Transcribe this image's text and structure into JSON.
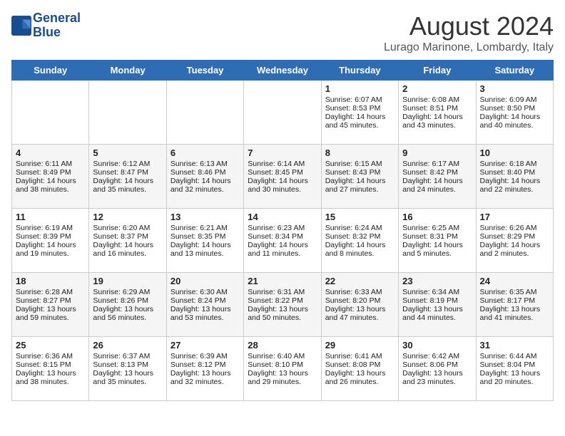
{
  "logo": {
    "line1": "General",
    "line2": "Blue"
  },
  "title": "August 2024",
  "subtitle": "Lurago Marinone, Lombardy, Italy",
  "days_of_week": [
    "Sunday",
    "Monday",
    "Tuesday",
    "Wednesday",
    "Thursday",
    "Friday",
    "Saturday"
  ],
  "weeks": [
    [
      {
        "day": "",
        "info": ""
      },
      {
        "day": "",
        "info": ""
      },
      {
        "day": "",
        "info": ""
      },
      {
        "day": "",
        "info": ""
      },
      {
        "day": "1",
        "info": "Sunrise: 6:07 AM\nSunset: 8:53 PM\nDaylight: 14 hours and 45 minutes."
      },
      {
        "day": "2",
        "info": "Sunrise: 6:08 AM\nSunset: 8:51 PM\nDaylight: 14 hours and 43 minutes."
      },
      {
        "day": "3",
        "info": "Sunrise: 6:09 AM\nSunset: 8:50 PM\nDaylight: 14 hours and 40 minutes."
      }
    ],
    [
      {
        "day": "4",
        "info": "Sunrise: 6:11 AM\nSunset: 8:49 PM\nDaylight: 14 hours and 38 minutes."
      },
      {
        "day": "5",
        "info": "Sunrise: 6:12 AM\nSunset: 8:47 PM\nDaylight: 14 hours and 35 minutes."
      },
      {
        "day": "6",
        "info": "Sunrise: 6:13 AM\nSunset: 8:46 PM\nDaylight: 14 hours and 32 minutes."
      },
      {
        "day": "7",
        "info": "Sunrise: 6:14 AM\nSunset: 8:45 PM\nDaylight: 14 hours and 30 minutes."
      },
      {
        "day": "8",
        "info": "Sunrise: 6:15 AM\nSunset: 8:43 PM\nDaylight: 14 hours and 27 minutes."
      },
      {
        "day": "9",
        "info": "Sunrise: 6:17 AM\nSunset: 8:42 PM\nDaylight: 14 hours and 24 minutes."
      },
      {
        "day": "10",
        "info": "Sunrise: 6:18 AM\nSunset: 8:40 PM\nDaylight: 14 hours and 22 minutes."
      }
    ],
    [
      {
        "day": "11",
        "info": "Sunrise: 6:19 AM\nSunset: 8:39 PM\nDaylight: 14 hours and 19 minutes."
      },
      {
        "day": "12",
        "info": "Sunrise: 6:20 AM\nSunset: 8:37 PM\nDaylight: 14 hours and 16 minutes."
      },
      {
        "day": "13",
        "info": "Sunrise: 6:21 AM\nSunset: 8:35 PM\nDaylight: 14 hours and 13 minutes."
      },
      {
        "day": "14",
        "info": "Sunrise: 6:23 AM\nSunset: 8:34 PM\nDaylight: 14 hours and 11 minutes."
      },
      {
        "day": "15",
        "info": "Sunrise: 6:24 AM\nSunset: 8:32 PM\nDaylight: 14 hours and 8 minutes."
      },
      {
        "day": "16",
        "info": "Sunrise: 6:25 AM\nSunset: 8:31 PM\nDaylight: 14 hours and 5 minutes."
      },
      {
        "day": "17",
        "info": "Sunrise: 6:26 AM\nSunset: 8:29 PM\nDaylight: 14 hours and 2 minutes."
      }
    ],
    [
      {
        "day": "18",
        "info": "Sunrise: 6:28 AM\nSunset: 8:27 PM\nDaylight: 13 hours and 59 minutes."
      },
      {
        "day": "19",
        "info": "Sunrise: 6:29 AM\nSunset: 8:26 PM\nDaylight: 13 hours and 56 minutes."
      },
      {
        "day": "20",
        "info": "Sunrise: 6:30 AM\nSunset: 8:24 PM\nDaylight: 13 hours and 53 minutes."
      },
      {
        "day": "21",
        "info": "Sunrise: 6:31 AM\nSunset: 8:22 PM\nDaylight: 13 hours and 50 minutes."
      },
      {
        "day": "22",
        "info": "Sunrise: 6:33 AM\nSunset: 8:20 PM\nDaylight: 13 hours and 47 minutes."
      },
      {
        "day": "23",
        "info": "Sunrise: 6:34 AM\nSunset: 8:19 PM\nDaylight: 13 hours and 44 minutes."
      },
      {
        "day": "24",
        "info": "Sunrise: 6:35 AM\nSunset: 8:17 PM\nDaylight: 13 hours and 41 minutes."
      }
    ],
    [
      {
        "day": "25",
        "info": "Sunrise: 6:36 AM\nSunset: 8:15 PM\nDaylight: 13 hours and 38 minutes."
      },
      {
        "day": "26",
        "info": "Sunrise: 6:37 AM\nSunset: 8:13 PM\nDaylight: 13 hours and 35 minutes."
      },
      {
        "day": "27",
        "info": "Sunrise: 6:39 AM\nSunset: 8:12 PM\nDaylight: 13 hours and 32 minutes."
      },
      {
        "day": "28",
        "info": "Sunrise: 6:40 AM\nSunset: 8:10 PM\nDaylight: 13 hours and 29 minutes."
      },
      {
        "day": "29",
        "info": "Sunrise: 6:41 AM\nSunset: 8:08 PM\nDaylight: 13 hours and 26 minutes."
      },
      {
        "day": "30",
        "info": "Sunrise: 6:42 AM\nSunset: 8:06 PM\nDaylight: 13 hours and 23 minutes."
      },
      {
        "day": "31",
        "info": "Sunrise: 6:44 AM\nSunset: 8:04 PM\nDaylight: 13 hours and 20 minutes."
      }
    ]
  ]
}
